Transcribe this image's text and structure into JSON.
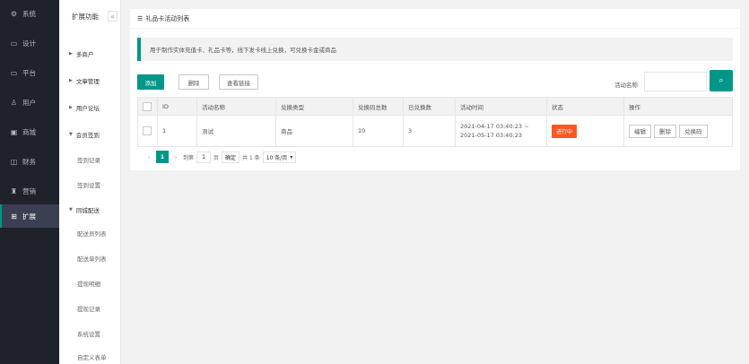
{
  "nav": {
    "items": [
      {
        "label": "系统",
        "icon": "gear-icon"
      },
      {
        "label": "设计",
        "icon": "monitor-icon"
      },
      {
        "label": "平台",
        "icon": "monitor-icon"
      },
      {
        "label": "用户",
        "icon": "user-icon"
      },
      {
        "label": "商城",
        "icon": "shop-icon"
      },
      {
        "label": "财务",
        "icon": "finance-icon"
      },
      {
        "label": "营销",
        "icon": "marketing-icon"
      },
      {
        "label": "扩展",
        "icon": "apps-icon"
      }
    ],
    "active_index": 7
  },
  "submenu": {
    "title": "扩展功能",
    "collapse_icon": "«",
    "groups": [
      "多商户",
      "文章管理",
      "用户论坛",
      "会员签到"
    ],
    "signin_children": [
      "签到记录",
      "签到设置"
    ],
    "group2": "同城配送",
    "delivery_children": [
      "配送员列表",
      "配送单列表",
      "提现明细",
      "提现记录",
      "系统设置",
      "自定义表单"
    ]
  },
  "page": {
    "title": "礼品卡活动列表",
    "notice": "用于制作实体充值卡、礼品卡等，线下发卡线上兑换，可兑换卡金或商品"
  },
  "toolbar": {
    "add_label": "添加",
    "delete_label": "删除",
    "link_label": "查看链接",
    "search_label": "活动名称",
    "search_value": "",
    "search_icon": "search-icon"
  },
  "table": {
    "headers": [
      "",
      "ID",
      "活动名称",
      "兑换类型",
      "兑换码总数",
      "已兑换数",
      "活动时间",
      "状态",
      "操作"
    ],
    "rows": [
      {
        "id": "1",
        "name": "测试",
        "type": "商品",
        "total": "10",
        "redeemed": "3",
        "time_start": "2021-04-17 03:40:23 ~",
        "time_end": "2021-05-17 03:40:23",
        "status": "进行中",
        "ops": [
          "编辑",
          "删除",
          "兑换码"
        ]
      }
    ]
  },
  "pager": {
    "prev": "‹",
    "current": "1",
    "next": "›",
    "goto_label": "到第",
    "goto_value": "1",
    "page_unit": "页",
    "confirm": "确定",
    "total": "共 1 条",
    "size": "10 条/页"
  },
  "colors": {
    "accent": "#009688",
    "nav_bg": "#20222a",
    "status": "#ff5722"
  }
}
